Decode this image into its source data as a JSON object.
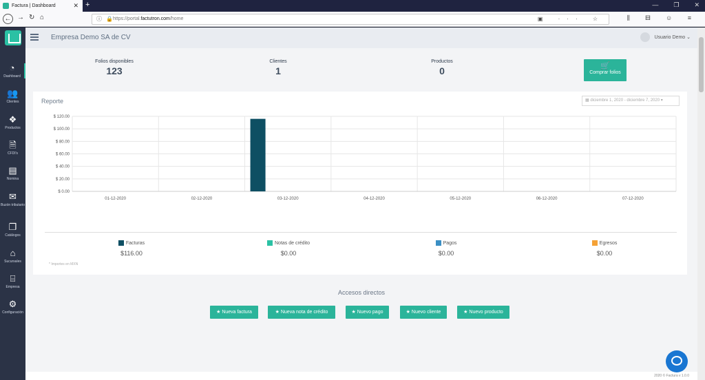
{
  "browser": {
    "tab_title": "Factura | Dashboard",
    "url_prefix": "https://portal.",
    "url_domain": "factutron.com",
    "url_path": "/home"
  },
  "topbar": {
    "company": "Empresa Demo SA de CV",
    "user": "Usuario Demo"
  },
  "sidebar": {
    "items": [
      {
        "label": "Dashboard",
        "icon": "dashboard-icon"
      },
      {
        "label": "Clientes",
        "icon": "users-icon"
      },
      {
        "label": "Productos",
        "icon": "cubes-icon"
      },
      {
        "label": "CFDI's",
        "icon": "file-icon"
      },
      {
        "label": "Nomina",
        "icon": "id-card-icon"
      },
      {
        "label": "Buzón tributario",
        "icon": "envelope-icon"
      },
      {
        "label": "Catálogos",
        "icon": "copy-icon"
      },
      {
        "label": "Sucursales",
        "icon": "home-icon"
      },
      {
        "label": "Empresa",
        "icon": "bank-icon"
      },
      {
        "label": "Configuración",
        "icon": "gear-icon"
      }
    ]
  },
  "stats": {
    "folios_label": "Folios disponibles",
    "folios_value": "123",
    "clientes_label": "Clientes",
    "clientes_value": "1",
    "productos_label": "Productos",
    "productos_value": "0",
    "buy_label": "Comprar folios"
  },
  "report": {
    "title": "Reporte",
    "date_range": "diciembre 1, 2020 - diciembre 7, 2020",
    "note": "* Importes en MXN",
    "legend": [
      {
        "name": "Facturas",
        "amount": "$116.00",
        "color": "#0e4f63"
      },
      {
        "name": "Notas de crédito",
        "amount": "$0.00",
        "color": "#2bc1a4"
      },
      {
        "name": "Pagos",
        "amount": "$0.00",
        "color": "#3b8fc4"
      },
      {
        "name": "Egresos",
        "amount": "$0.00",
        "color": "#f5a236"
      }
    ]
  },
  "chart_data": {
    "type": "bar",
    "categories": [
      "01-12-2020",
      "02-12-2020",
      "03-12-2020",
      "04-12-2020",
      "05-12-2020",
      "06-12-2020",
      "07-12-2020"
    ],
    "series": [
      {
        "name": "Facturas",
        "values": [
          0,
          0,
          116,
          0,
          0,
          0,
          0
        ]
      },
      {
        "name": "Notas de crédito",
        "values": [
          0,
          0,
          0,
          0,
          0,
          0,
          0
        ]
      },
      {
        "name": "Pagos",
        "values": [
          0,
          0,
          0,
          0,
          0,
          0,
          0
        ]
      },
      {
        "name": "Egresos",
        "values": [
          0,
          0,
          0,
          0,
          0,
          0,
          0
        ]
      }
    ],
    "yticks": [
      "$ 0.00",
      "$ 20.00",
      "$ 40.00",
      "$ 60.00",
      "$ 80.00",
      "$ 100.00",
      "$ 120.00"
    ],
    "ylim": [
      0,
      120
    ],
    "grid": true
  },
  "quick": {
    "title": "Accesos directos",
    "buttons": [
      "Nueva factura",
      "Nueva nota de crédito",
      "Nuevo pago",
      "Nuevo cliente",
      "Nuevo producto"
    ]
  },
  "footer": {
    "text": "2020 © Factura v 1.0.0"
  }
}
